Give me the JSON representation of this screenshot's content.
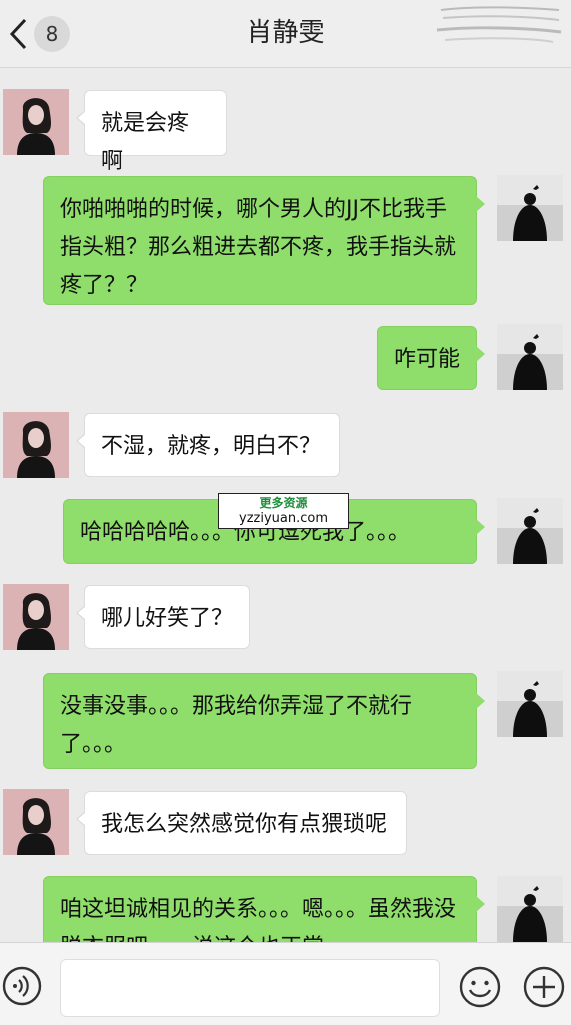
{
  "header": {
    "back_icon": "chevron-left-icon",
    "unread_count": "8",
    "title": "肖静雯"
  },
  "messages": [
    {
      "side": "left",
      "text": "就是会疼啊"
    },
    {
      "side": "right",
      "text": "你啪啪啪的时候，哪个男人的JJ不比我手指头粗？那么粗进去都不疼，我手指头就疼了？？"
    },
    {
      "side": "right",
      "text": "咋可能"
    },
    {
      "side": "left",
      "text": "不湿，就疼，明白不？"
    },
    {
      "side": "right",
      "text": "哈哈哈哈哈。。。你可逗死我了。。。"
    },
    {
      "side": "left",
      "text": "哪儿好笑了？"
    },
    {
      "side": "right",
      "text": "没事没事。。。那我给你弄湿了不就行了。。。"
    },
    {
      "side": "left",
      "text": "我怎么突然感觉你有点猥琐呢"
    },
    {
      "side": "right",
      "text": "咱这坦诚相见的关系。。。嗯。。。虽然我没脱衣服吧。。。说这个也正常"
    }
  ],
  "watermark": {
    "line1": "更多资源",
    "line2": "yzziyuan.com"
  },
  "input_bar": {
    "voice_icon": "voice-icon",
    "input_value": "",
    "emoji_icon": "emoji-icon",
    "plus_icon": "plus-icon"
  },
  "colors": {
    "outgoing_bubble": "#8fdd6a",
    "incoming_bubble": "#ffffff",
    "background": "#ebebeb"
  }
}
